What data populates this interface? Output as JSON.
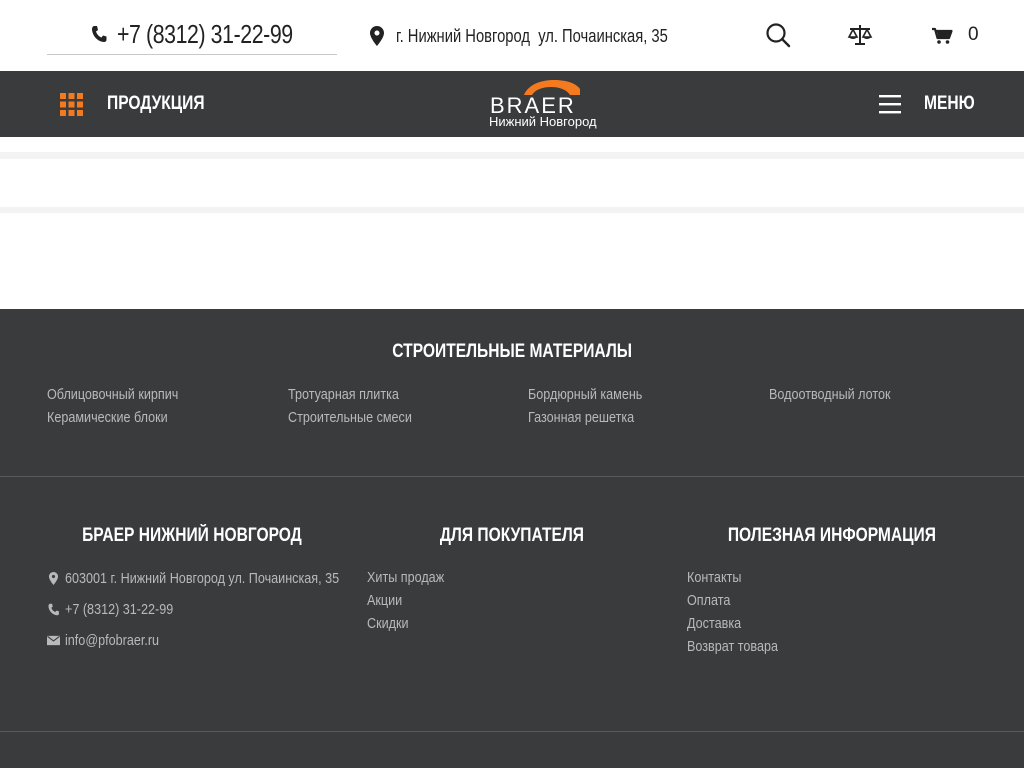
{
  "topbar": {
    "phone": "+7 (8312) 31-22-99",
    "address": "г. Нижний Новгород  ул. Почаинская, 35",
    "cart_count": "0"
  },
  "navbar": {
    "products_label": "ПРОДУКЦИЯ",
    "logo_brand": "BRAER",
    "logo_city": "Нижний Новгород",
    "menu_label": "МЕНЮ"
  },
  "colors": {
    "accent": "#f47a20",
    "dark": "#3a3b3d",
    "link": "#b9b9b9"
  },
  "footer": {
    "catalog_title": "СТРОИТЕЛЬНЫЕ МАТЕРИАЛЫ",
    "catalog_columns": [
      [
        "Облицовочный кирпич",
        "Керамические блоки"
      ],
      [
        "Тротуарная плитка",
        "Строительные смеси"
      ],
      [
        "Бордюрный камень",
        "Газонная решетка"
      ],
      [
        "Водоотводный лоток"
      ]
    ],
    "company_title": "БРАЕР НИЖНИЙ НОВГОРОД",
    "company_address": "603001 г. Нижний Новгород ул. Почаинская, 35",
    "company_phone": "+7 (8312) 31-22-99",
    "company_email": "info@pfobraer.ru",
    "buyer_title": "ДЛЯ ПОКУПАТЕЛЯ",
    "buyer_links": [
      "Хиты продаж",
      "Акции",
      "Скидки"
    ],
    "info_title": "ПОЛЕЗНАЯ ИНФОРМАЦИЯ",
    "info_links": [
      "Контакты",
      "Оплата",
      "Доставка",
      "Возврат товара"
    ]
  }
}
